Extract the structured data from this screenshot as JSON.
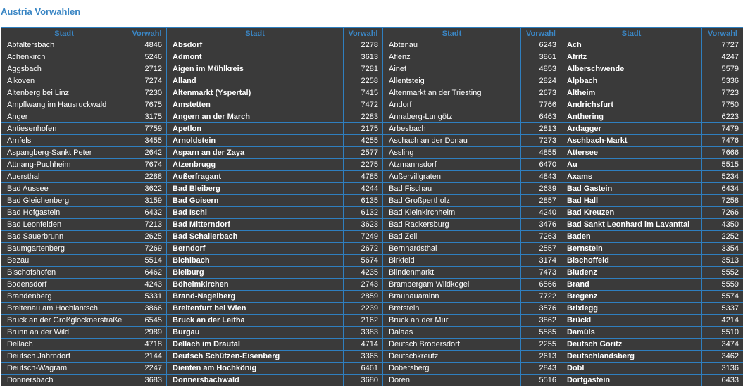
{
  "title": "Austria Vorwahlen",
  "headers": [
    {
      "city": "Stadt",
      "code": "Vorwahl"
    },
    {
      "city": "Stadt",
      "code": "Vorwahl"
    },
    {
      "city": "Stadt",
      "code": "Vorwahl"
    },
    {
      "city": "Stadt",
      "code": "Vorwahl"
    }
  ],
  "rows": [
    [
      [
        "Abfaltersbach",
        "4846"
      ],
      [
        "Absdorf",
        "2278"
      ],
      [
        "Abtenau",
        "6243"
      ],
      [
        "Ach",
        "7727"
      ]
    ],
    [
      [
        "Achenkirch",
        "5246"
      ],
      [
        "Admont",
        "3613"
      ],
      [
        "Aflenz",
        "3861"
      ],
      [
        "Afritz",
        "4247"
      ]
    ],
    [
      [
        "Aggsbach",
        "2712"
      ],
      [
        "Aigen im Mühlkreis",
        "7281"
      ],
      [
        "Ainet",
        "4853"
      ],
      [
        "Alberschwende",
        "5579"
      ]
    ],
    [
      [
        "Alkoven",
        "7274"
      ],
      [
        "Alland",
        "2258"
      ],
      [
        "Allentsteig",
        "2824"
      ],
      [
        "Alpbach",
        "5336"
      ]
    ],
    [
      [
        "Altenberg bei Linz",
        "7230"
      ],
      [
        "Altenmarkt (Yspertal)",
        "7415"
      ],
      [
        "Altenmarkt an der Triesting",
        "2673"
      ],
      [
        "Altheim",
        "7723"
      ]
    ],
    [
      [
        "Ampflwang im Hausruckwald",
        "7675"
      ],
      [
        "Amstetten",
        "7472"
      ],
      [
        "Andorf",
        "7766"
      ],
      [
        "Andrichsfurt",
        "7750"
      ]
    ],
    [
      [
        "Anger",
        "3175"
      ],
      [
        "Angern an der March",
        "2283"
      ],
      [
        "Annaberg-Lungötz",
        "6463"
      ],
      [
        "Anthering",
        "6223"
      ]
    ],
    [
      [
        "Antiesenhofen",
        "7759"
      ],
      [
        "Apetlon",
        "2175"
      ],
      [
        "Arbesbach",
        "2813"
      ],
      [
        "Ardagger",
        "7479"
      ]
    ],
    [
      [
        "Arnfels",
        "3455"
      ],
      [
        "Arnoldstein",
        "4255"
      ],
      [
        "Aschach an der Donau",
        "7273"
      ],
      [
        "Aschbach-Markt",
        "7476"
      ]
    ],
    [
      [
        "Aspangberg-Sankt Peter",
        "2642"
      ],
      [
        "Asparn an der Zaya",
        "2577"
      ],
      [
        "Assling",
        "4855"
      ],
      [
        "Attersee",
        "7666"
      ]
    ],
    [
      [
        "Attnang-Puchheim",
        "7674"
      ],
      [
        "Atzenbrugg",
        "2275"
      ],
      [
        "Atzmannsdorf",
        "6470"
      ],
      [
        "Au",
        "5515"
      ]
    ],
    [
      [
        "Auersthal",
        "2288"
      ],
      [
        "Außerfragant",
        "4785"
      ],
      [
        "Außervillgraten",
        "4843"
      ],
      [
        "Axams",
        "5234"
      ]
    ],
    [
      [
        "Bad Aussee",
        "3622"
      ],
      [
        "Bad Bleiberg",
        "4244"
      ],
      [
        "Bad Fischau",
        "2639"
      ],
      [
        "Bad Gastein",
        "6434"
      ]
    ],
    [
      [
        "Bad Gleichenberg",
        "3159"
      ],
      [
        "Bad Goisern",
        "6135"
      ],
      [
        "Bad Großpertholz",
        "2857"
      ],
      [
        "Bad Hall",
        "7258"
      ]
    ],
    [
      [
        "Bad Hofgastein",
        "6432"
      ],
      [
        "Bad Ischl",
        "6132"
      ],
      [
        "Bad Kleinkirchheim",
        "4240"
      ],
      [
        "Bad Kreuzen",
        "7266"
      ]
    ],
    [
      [
        "Bad Leonfelden",
        "7213"
      ],
      [
        "Bad Mitterndorf",
        "3623"
      ],
      [
        "Bad Radkersburg",
        "3476"
      ],
      [
        "Bad Sankt Leonhard im Lavanttal",
        "4350"
      ]
    ],
    [
      [
        "Bad Sauerbrunn",
        "2625"
      ],
      [
        "Bad Schallerbach",
        "7249"
      ],
      [
        "Bad Zell",
        "7263"
      ],
      [
        "Baden",
        "2252"
      ]
    ],
    [
      [
        "Baumgartenberg",
        "7269"
      ],
      [
        "Berndorf",
        "2672"
      ],
      [
        "Bernhardsthal",
        "2557"
      ],
      [
        "Bernstein",
        "3354"
      ]
    ],
    [
      [
        "Bezau",
        "5514"
      ],
      [
        "Bichlbach",
        "5674"
      ],
      [
        "Birkfeld",
        "3174"
      ],
      [
        "Bischoffeld",
        "3513"
      ]
    ],
    [
      [
        "Bischofshofen",
        "6462"
      ],
      [
        "Bleiburg",
        "4235"
      ],
      [
        "Blindenmarkt",
        "7473"
      ],
      [
        "Bludenz",
        "5552"
      ]
    ],
    [
      [
        "Bodensdorf",
        "4243"
      ],
      [
        "Böheimkirchen",
        "2743"
      ],
      [
        "Brambergam Wildkogel",
        "6566"
      ],
      [
        "Brand",
        "5559"
      ]
    ],
    [
      [
        "Brandenberg",
        "5331"
      ],
      [
        "Brand-Nagelberg",
        "2859"
      ],
      [
        "Braunauaminn",
        "7722"
      ],
      [
        "Bregenz",
        "5574"
      ]
    ],
    [
      [
        "Breitenau am Hochlantsch",
        "3866"
      ],
      [
        "Breitenfurt bei Wien",
        "2239"
      ],
      [
        "Bretstein",
        "3576"
      ],
      [
        "Brixlegg",
        "5337"
      ]
    ],
    [
      [
        "Bruck an der Großglocknerstraße",
        "6545"
      ],
      [
        "Bruck an der Leitha",
        "2162"
      ],
      [
        "Bruck an der Mur",
        "3862"
      ],
      [
        "Brückl",
        "4214"
      ]
    ],
    [
      [
        "Brunn an der Wild",
        "2989"
      ],
      [
        "Burgau",
        "3383"
      ],
      [
        "Dalaas",
        "5585"
      ],
      [
        "Damüls",
        "5510"
      ]
    ],
    [
      [
        "Dellach",
        "4718"
      ],
      [
        "Dellach im Drautal",
        "4714"
      ],
      [
        "Deutsch Brodersdorf",
        "2255"
      ],
      [
        "Deutsch Goritz",
        "3474"
      ]
    ],
    [
      [
        "Deutsch Jahrndorf",
        "2144"
      ],
      [
        "Deutsch Schützen-Eisenberg",
        "3365"
      ],
      [
        "Deutschkreutz",
        "2613"
      ],
      [
        "Deutschlandsberg",
        "3462"
      ]
    ],
    [
      [
        "Deutsch-Wagram",
        "2247"
      ],
      [
        "Dienten am Hochkönig",
        "6461"
      ],
      [
        "Dobersberg",
        "2843"
      ],
      [
        "Dobl",
        "3136"
      ]
    ],
    [
      [
        "Donnersbach",
        "3683"
      ],
      [
        "Donnersbachwald",
        "3680"
      ],
      [
        "Doren",
        "5516"
      ],
      [
        "Dorfgastein",
        "6433"
      ]
    ]
  ]
}
